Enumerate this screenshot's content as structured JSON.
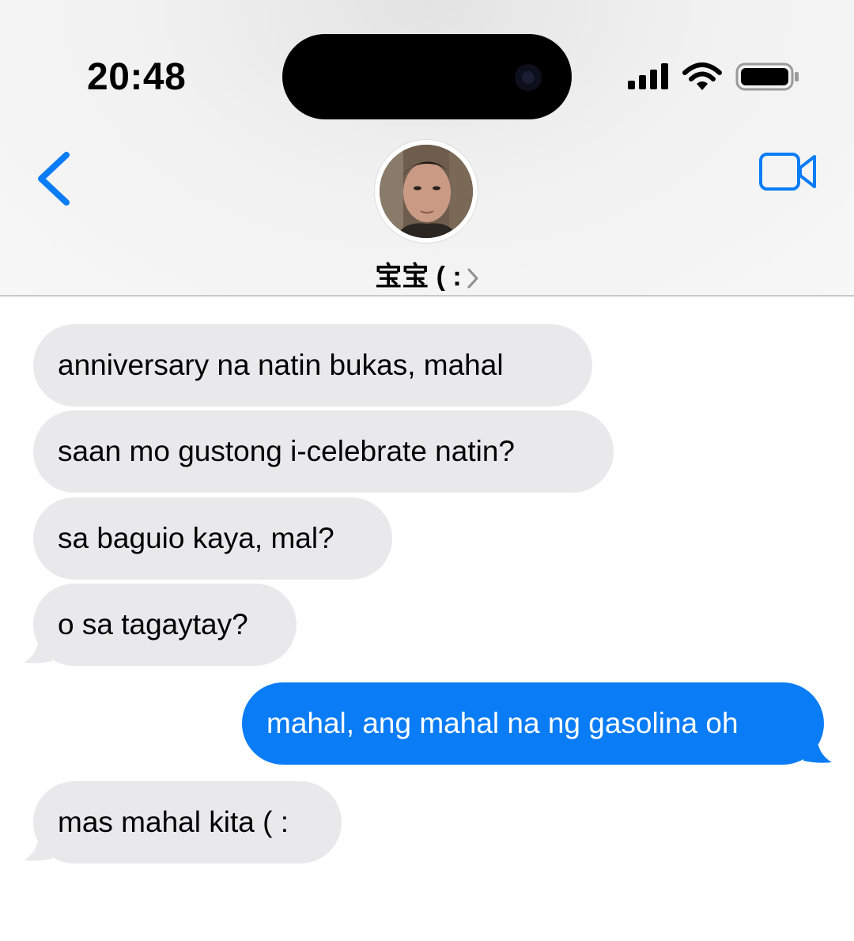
{
  "status_bar": {
    "time": "20:48",
    "icons": [
      "signal-icon",
      "wifi-icon",
      "battery-icon"
    ]
  },
  "nav": {
    "back_icon": "chevron-left-icon",
    "contact_name": "宝宝 ( :",
    "chevron_icon": "chevron-right-icon",
    "video_icon": "video-camera-icon"
  },
  "messages": [
    {
      "direction": "incoming",
      "text": "anniversary na natin bukas, mahal"
    },
    {
      "direction": "incoming",
      "text": "saan mo gustong i-celebrate natin?"
    },
    {
      "direction": "incoming",
      "text": "sa baguio kaya, mal?"
    },
    {
      "direction": "incoming",
      "text": "o sa tagaytay?"
    },
    {
      "direction": "outgoing",
      "text": "mahal, ang mahal na ng gasolina oh"
    },
    {
      "direction": "incoming",
      "text": "mas mahal kita ( :"
    }
  ],
  "colors": {
    "accent": "#0a7cf5",
    "incoming_bubble": "#e9e9eb",
    "outgoing_bubble": "#0a7cf5"
  }
}
